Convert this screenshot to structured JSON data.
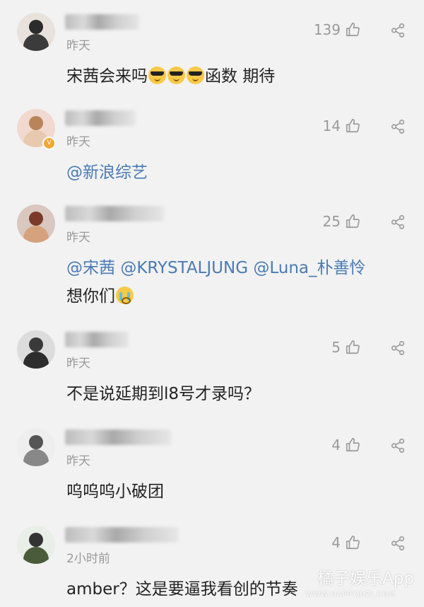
{
  "comments": [
    {
      "time": "昨天",
      "likes": "139",
      "lines": [
        [
          {
            "text": "宋茜会来吗"
          },
          {
            "emoji": "cool"
          },
          {
            "emoji": "cool"
          },
          {
            "emoji": "cool"
          },
          {
            "text": "函数 期待"
          }
        ]
      ]
    },
    {
      "time": "昨天",
      "likes": "14",
      "verified": true,
      "lines": [
        [
          {
            "text": "@新浪综艺",
            "mention": true
          }
        ]
      ]
    },
    {
      "time": "昨天",
      "likes": "25",
      "lines": [
        [
          {
            "text": "@宋茜",
            "mention": true
          },
          {
            "text": " "
          },
          {
            "text": "@KRYSTALJUNG",
            "mention": true
          },
          {
            "text": " "
          },
          {
            "text": "@Luna_朴善怜",
            "mention": true
          }
        ],
        [
          {
            "text": "想你们"
          },
          {
            "emoji": "cry"
          }
        ]
      ]
    },
    {
      "time": "昨天",
      "likes": "5",
      "lines": [
        [
          {
            "text": "不是说延期到l8号才录吗？"
          }
        ]
      ]
    },
    {
      "time": "昨天",
      "likes": "4",
      "lines": [
        [
          {
            "text": "呜呜呜小破团"
          }
        ]
      ]
    },
    {
      "time": "2小时前",
      "likes": "4",
      "lines": [
        [
          {
            "text": "amber？这是要逼我看创的节奏"
          }
        ]
      ]
    }
  ],
  "watermark": {
    "brand": "橘子娱乐App",
    "url": "WWW.HAPPYJUZI.COM"
  },
  "colors": {
    "background": "#f2f2f2",
    "mention": "#4a7bb4",
    "meta": "#9a9a9a",
    "text": "#222222"
  }
}
